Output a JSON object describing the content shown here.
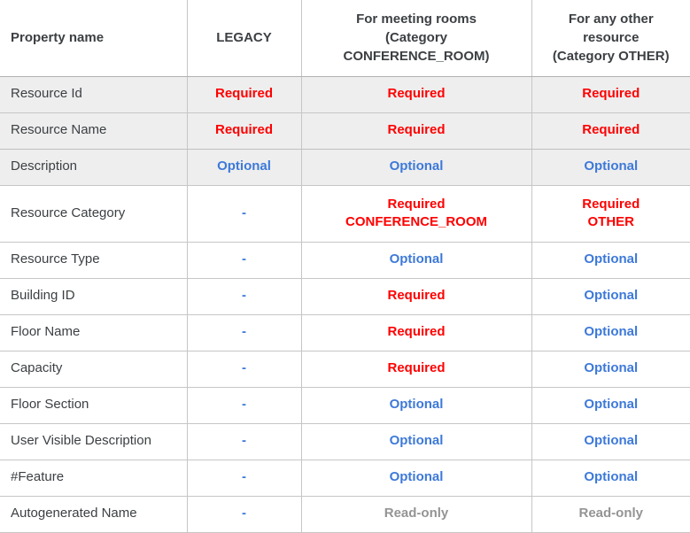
{
  "table": {
    "columns": [
      {
        "key": "property_name",
        "label": "Property name",
        "align": "left"
      },
      {
        "key": "legacy",
        "label": "LEGACY",
        "align": "center"
      },
      {
        "key": "conference_room",
        "label": "For meeting rooms (Category CONFERENCE_ROOM)",
        "line1": "For meeting rooms",
        "line2": "(Category",
        "line3": "CONFERENCE_ROOM)",
        "align": "center"
      },
      {
        "key": "other",
        "label": "For any other resource (Category OTHER)",
        "line1": "For any other",
        "line2": "resource",
        "line3": "(Category OTHER)",
        "align": "center"
      }
    ],
    "status_colors": {
      "required": "#ff0000",
      "optional": "#3d79d9",
      "read_only": "#949494",
      "dash": "#3d79d9",
      "header_text": "#3c4043",
      "row_shaded_bg": "#eeeeee",
      "row_plain_bg": "#ffffff",
      "border": "#c6c6c6"
    },
    "status_labels": {
      "required": "Required",
      "optional": "Optional",
      "read_only": "Read-only",
      "not_applicable": "-"
    },
    "rows": [
      {
        "property_name": "Resource Id",
        "shaded": true,
        "legacy": "Required",
        "legacy_kind": "required",
        "conference_room": "Required",
        "conference_room_kind": "required",
        "other": "Required",
        "other_kind": "required"
      },
      {
        "property_name": "Resource Name",
        "shaded": true,
        "legacy": "Required",
        "legacy_kind": "required",
        "conference_room": "Required",
        "conference_room_kind": "required",
        "other": "Required",
        "other_kind": "required"
      },
      {
        "property_name": "Description",
        "shaded": true,
        "legacy": "Optional",
        "legacy_kind": "optional",
        "conference_room": "Optional",
        "conference_room_kind": "optional",
        "other": "Optional",
        "other_kind": "optional"
      },
      {
        "property_name": "Resource Category",
        "shaded": false,
        "tall": true,
        "legacy": "-",
        "legacy_kind": "dash",
        "conference_room": "Required",
        "conference_room_sub": "CONFERENCE_ROOM",
        "conference_room_kind": "required",
        "other": "Required",
        "other_sub": "OTHER",
        "other_kind": "required"
      },
      {
        "property_name": "Resource Type",
        "shaded": false,
        "legacy": "-",
        "legacy_kind": "dash",
        "conference_room": "Optional",
        "conference_room_kind": "optional",
        "other": "Optional",
        "other_kind": "optional"
      },
      {
        "property_name": "Building ID",
        "shaded": false,
        "legacy": "-",
        "legacy_kind": "dash",
        "conference_room": "Required",
        "conference_room_kind": "required",
        "other": "Optional",
        "other_kind": "optional"
      },
      {
        "property_name": "Floor Name",
        "shaded": false,
        "legacy": "-",
        "legacy_kind": "dash",
        "conference_room": "Required",
        "conference_room_kind": "required",
        "other": "Optional",
        "other_kind": "optional"
      },
      {
        "property_name": "Capacity",
        "shaded": false,
        "legacy": "-",
        "legacy_kind": "dash",
        "conference_room": "Required",
        "conference_room_kind": "required",
        "other": "Optional",
        "other_kind": "optional"
      },
      {
        "property_name": "Floor Section",
        "shaded": false,
        "legacy": "-",
        "legacy_kind": "dash",
        "conference_room": "Optional",
        "conference_room_kind": "optional",
        "other": "Optional",
        "other_kind": "optional"
      },
      {
        "property_name": "User Visible Description",
        "shaded": false,
        "legacy": "-",
        "legacy_kind": "dash",
        "conference_room": "Optional",
        "conference_room_kind": "optional",
        "other": "Optional",
        "other_kind": "optional"
      },
      {
        "property_name": "#Feature",
        "shaded": false,
        "legacy": "-",
        "legacy_kind": "dash",
        "conference_room": "Optional",
        "conference_room_kind": "optional",
        "other": "Optional",
        "other_kind": "optional"
      },
      {
        "property_name": "Autogenerated Name",
        "shaded": false,
        "legacy": "-",
        "legacy_kind": "dash",
        "conference_room": "Read-only",
        "conference_room_kind": "read_only",
        "other": "Read-only",
        "other_kind": "read_only"
      }
    ]
  }
}
